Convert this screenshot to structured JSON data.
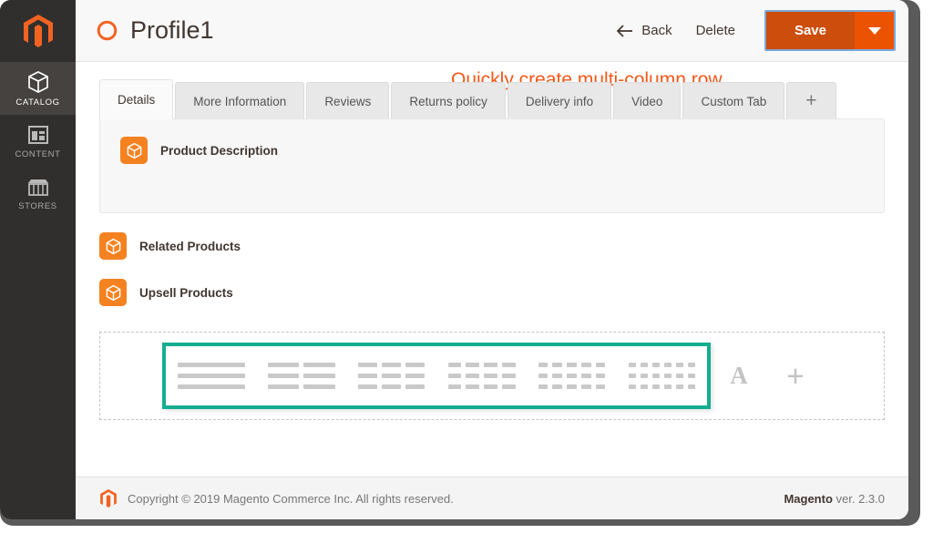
{
  "sidebar": {
    "logo_icon": "magento-logo-icon",
    "items": [
      {
        "label": "CATALOG",
        "icon": "box-icon",
        "active": true
      },
      {
        "label": "CONTENT",
        "icon": "layout-icon",
        "active": false
      },
      {
        "label": "STORES",
        "icon": "storefront-icon",
        "active": false
      }
    ]
  },
  "header": {
    "title": "Profile1",
    "title_icon": "orange-circle-icon",
    "back_label": "Back",
    "back_icon": "arrow-left-icon",
    "delete_label": "Delete",
    "save_label": "Save",
    "save_dropdown_icon": "caret-down-icon"
  },
  "tabs": [
    {
      "label": "Details",
      "active": true
    },
    {
      "label": "More Information",
      "active": false
    },
    {
      "label": "Reviews",
      "active": false
    },
    {
      "label": "Returns policy",
      "active": false
    },
    {
      "label": "Delivery info",
      "active": false
    },
    {
      "label": "Video",
      "active": false
    },
    {
      "label": "Custom Tab",
      "active": false
    }
  ],
  "add_tab_label": "+",
  "panel": {
    "description_label": "Product Description",
    "description_icon": "box-icon"
  },
  "stages": [
    {
      "label": "Related Products",
      "icon": "box-icon"
    },
    {
      "label": "Upsell Products",
      "icon": "box-icon"
    }
  ],
  "column_picker": {
    "options": [
      {
        "columns": 1,
        "name": "one-column-layout"
      },
      {
        "columns": 2,
        "name": "two-column-layout"
      },
      {
        "columns": 3,
        "name": "three-column-layout"
      },
      {
        "columns": 4,
        "name": "four-column-layout"
      },
      {
        "columns": 5,
        "name": "five-column-layout"
      },
      {
        "columns": 6,
        "name": "six-column-layout"
      }
    ],
    "highlight_color": "#15ad8f",
    "text_tool_label": "A",
    "add_tool_label": "+"
  },
  "annotation": {
    "text": "Quickly create multi-column row",
    "color": "#f4581b"
  },
  "footer": {
    "copyright": "Copyright © 2019 Magento Commerce Inc. All rights reserved.",
    "brand": "Magento",
    "version": " ver. 2.3.0",
    "logo_icon": "magento-logo-icon"
  },
  "colors": {
    "accent_orange": "#f58220",
    "save_orange": "#cc4d0c",
    "teal": "#15ad8f",
    "sidebar_dark": "#312f2d"
  }
}
